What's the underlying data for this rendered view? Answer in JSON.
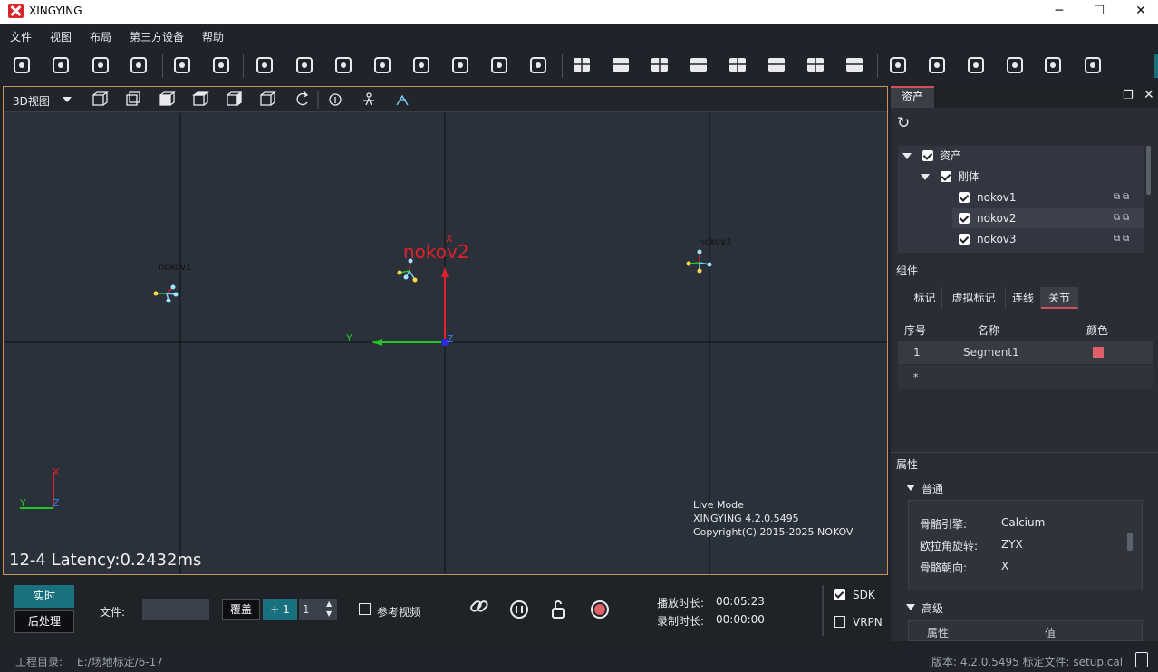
{
  "window": {
    "title": "XINGYING",
    "controls": [
      "─",
      "☐",
      "✕"
    ]
  },
  "menu": [
    "文件",
    "视图",
    "布局",
    "第三方设备",
    "帮助"
  ],
  "toolbar": {
    "icons": [
      "open-folder-icon",
      "ruler-icon",
      "save-icon",
      "save-as-icon",
      "hide-icon",
      "mirror-icon",
      "camera-icon",
      "fullscreen-icon",
      "calibrate-icon",
      "video-icon",
      "replay-icon",
      "layers-icon",
      "network-icon",
      "settings-icon",
      "layout-1-icon",
      "layout-2-icon",
      "layout-3-icon",
      "layout-4-icon",
      "layout-5-icon",
      "layout-6-icon",
      "layout-7-icon",
      "layout-8-icon",
      "capture-icon",
      "2d-icon",
      "3d-icon",
      "speed-icon",
      "skeleton-icon",
      "bar-chart-icon"
    ]
  },
  "viewport": {
    "view_label": "3D视图",
    "grid": true,
    "markers": [
      {
        "name": "nokov1"
      },
      {
        "name": "nokov2"
      },
      {
        "name": "nokov3"
      }
    ],
    "axis_labels": {
      "x": "X",
      "y": "Y",
      "z": "Z"
    },
    "info": [
      "Live Mode",
      "XINGYING 4.2.0.5495",
      "Copyright(C) 2015-2025 NOKOV"
    ],
    "latency": "12-4 Latency:0.2432ms",
    "selected_label": "nokov2"
  },
  "panel": {
    "tab": "资产",
    "tree": {
      "root": "资产",
      "group": "刚体",
      "items": [
        {
          "label": "nokov1",
          "checked": true
        },
        {
          "label": "nokov2",
          "checked": true,
          "selected": true
        },
        {
          "label": "nokov3",
          "checked": true
        }
      ]
    },
    "components_label": "组件",
    "component_tabs": [
      "标记",
      "虚拟标记",
      "连线",
      "关节"
    ],
    "active_component_tab": "关节",
    "grid_headers": [
      "序号",
      "名称",
      "颜色"
    ],
    "grid_rows": [
      {
        "index": "1",
        "name": "Segment1",
        "color": "#e0606a"
      }
    ],
    "new_row": "*",
    "properties_label": "属性",
    "general_label": "普通",
    "properties": [
      {
        "key": "骨骼引擎:",
        "value": "Calcium"
      },
      {
        "key": "欧拉角旋转:",
        "value": "ZYX"
      },
      {
        "key": "骨骼朝向:",
        "value": "X"
      }
    ],
    "advanced_label": "高级",
    "advanced_headers": [
      "属性",
      "值"
    ]
  },
  "bottom": {
    "realtime": "实时",
    "postprocess": "后处理",
    "file_label": "文件:",
    "overwrite": "覆盖",
    "plus_one": "+ 1",
    "stepper_value": "1",
    "ref_video": "参考视频",
    "play_duration_label": "播放时长:",
    "play_duration": "00:05:23",
    "record_duration_label": "录制时长:",
    "record_duration": "00:00:00",
    "sdk": {
      "label": "SDK",
      "checked": true
    },
    "vrpn": {
      "label": "VRPN",
      "checked": false
    }
  },
  "status": {
    "project_label": "工程目录:",
    "project_path": "E:/场地标定/6-17",
    "version": "版本: 4.2.0.5495 标定文件: setup.cal"
  }
}
